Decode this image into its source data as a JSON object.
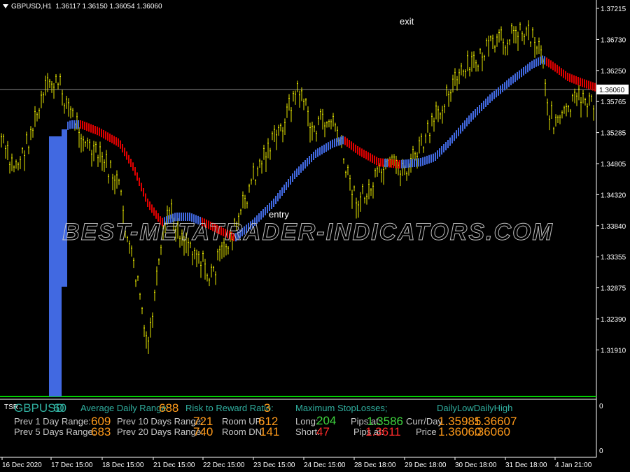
{
  "header": {
    "symbol_timeframe": "GBPUSD,H1",
    "ohlc": "1.36117 1.36150 1.36054 1.36060"
  },
  "annotations": {
    "exit": "exit",
    "entry": "entry"
  },
  "watermark": "BEST-METATRADER-INDICATORS.COM",
  "price_axis": {
    "ticks": [
      "1.37215",
      "1.36730",
      "1.36250",
      "1.35765",
      "1.35285",
      "1.34805",
      "1.34320",
      "1.33840",
      "1.33355",
      "1.32875",
      "1.32390",
      "1.31910"
    ],
    "current_price": "1.36060"
  },
  "sub_axis": {
    "top": "0",
    "bottom": "0"
  },
  "time_axis": {
    "labels": [
      "16 Dec 2020",
      "17 Dec 15:00",
      "18 Dec 15:00",
      "21 Dec 15:00",
      "22 Dec 15:00",
      "23 Dec 15:00",
      "24 Dec 15:00",
      "28 Dec 18:00",
      "29 Dec 18:00",
      "30 Dec 18:00",
      "31 Dec 18:00",
      "4 Jan 21:00"
    ]
  },
  "indicator": {
    "short_name": "TSR",
    "symbol": "GBPUSD",
    "symbol_value": "60",
    "adr_label": "Average Daily Range:",
    "adr_value": "688",
    "rr_label": "Risk to Reward Ratio:",
    "rr_value": "3",
    "msl_label": "Maximum StopLosses;",
    "daily_label": "DailyLowDailyHigh",
    "prev1_label": "Prev 1 Day Range:",
    "prev1_value": "609",
    "prev10_label": "Prev 10 Days Range:",
    "prev10_value": "721",
    "roomup_label": "Room UP:",
    "roomup_value": "612",
    "long_label": "Long:",
    "long_value": "204",
    "pipsat1_label": "Pips at:",
    "pipsat1_value": "1.3586",
    "currday_label": "Curr/Day",
    "currday_low": "1.35985",
    "currday_high": "1.36607",
    "prev5_label": "Prev 5 Days Range:",
    "prev5_value": "683",
    "prev20_label": "Prev 20 Days Range:",
    "prev20_value": "740",
    "roomdn_label": "Room DN:",
    "roomdn_value": "141",
    "short_label": "Short:",
    "short_value": "47",
    "pipsat2_label": "Pips at:",
    "pipsat2_value": "1.3611",
    "price_label": "Price",
    "price_low": "1.36060",
    "price_high": ".36060"
  },
  "colors": {
    "background": "#000000",
    "candles": "#e6e600",
    "band_up": "#4169e1",
    "band_down": "#e00000",
    "signal_line": "#00d000",
    "axis": "#ffffff"
  }
}
